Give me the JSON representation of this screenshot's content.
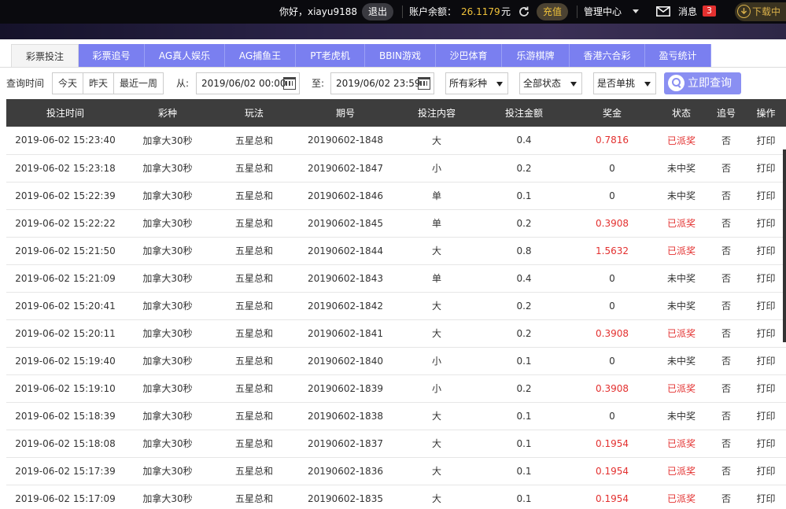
{
  "topbar": {
    "greeting": "你好，xiayu9188",
    "logout": "退出",
    "balance_label": "账户余额：",
    "balance_value": "26.1179",
    "balance_unit": "元",
    "recharge": "充值",
    "manage": "管理中心",
    "messages": "消息",
    "message_count": "3",
    "download": "下载中"
  },
  "tabs": [
    "彩票投注",
    "彩票追号",
    "AG真人娱乐",
    "AG捕鱼王",
    "PT老虎机",
    "BBIN游戏",
    "沙巴体育",
    "乐游棋牌",
    "香港六合彩",
    "盈亏统计"
  ],
  "filters": {
    "query_label": "查询时间",
    "quick": [
      "今天",
      "昨天",
      "最近一周"
    ],
    "from_label": "从:",
    "from_value": "2019/06/02 00:00",
    "to_label": "至:",
    "to_value": "2019/06/02 23:59",
    "lottery_select": "所有彩种",
    "status_select": "全部状态",
    "single_select": "是否单挑",
    "search_button": "立即查询"
  },
  "table": {
    "headers": [
      "投注时间",
      "彩种",
      "玩法",
      "期号",
      "投注内容",
      "投注金额",
      "奖金",
      "状态",
      "追号",
      "操作"
    ],
    "rows": [
      [
        "2019-06-02 15:23:40",
        "加拿大30秒",
        "五星总和",
        "20190602-1848",
        "大",
        "0.4",
        "0.7816",
        "已派奖",
        "否",
        "打印"
      ],
      [
        "2019-06-02 15:23:18",
        "加拿大30秒",
        "五星总和",
        "20190602-1847",
        "小",
        "0.2",
        "0",
        "未中奖",
        "否",
        "打印"
      ],
      [
        "2019-06-02 15:22:39",
        "加拿大30秒",
        "五星总和",
        "20190602-1846",
        "单",
        "0.1",
        "0",
        "未中奖",
        "否",
        "打印"
      ],
      [
        "2019-06-02 15:22:22",
        "加拿大30秒",
        "五星总和",
        "20190602-1845",
        "单",
        "0.2",
        "0.3908",
        "已派奖",
        "否",
        "打印"
      ],
      [
        "2019-06-02 15:21:50",
        "加拿大30秒",
        "五星总和",
        "20190602-1844",
        "大",
        "0.8",
        "1.5632",
        "已派奖",
        "否",
        "打印"
      ],
      [
        "2019-06-02 15:21:09",
        "加拿大30秒",
        "五星总和",
        "20190602-1843",
        "单",
        "0.4",
        "0",
        "未中奖",
        "否",
        "打印"
      ],
      [
        "2019-06-02 15:20:41",
        "加拿大30秒",
        "五星总和",
        "20190602-1842",
        "大",
        "0.2",
        "0",
        "未中奖",
        "否",
        "打印"
      ],
      [
        "2019-06-02 15:20:11",
        "加拿大30秒",
        "五星总和",
        "20190602-1841",
        "大",
        "0.2",
        "0.3908",
        "已派奖",
        "否",
        "打印"
      ],
      [
        "2019-06-02 15:19:40",
        "加拿大30秒",
        "五星总和",
        "20190602-1840",
        "小",
        "0.1",
        "0",
        "未中奖",
        "否",
        "打印"
      ],
      [
        "2019-06-02 15:19:10",
        "加拿大30秒",
        "五星总和",
        "20190602-1839",
        "小",
        "0.2",
        "0.3908",
        "已派奖",
        "否",
        "打印"
      ],
      [
        "2019-06-02 15:18:39",
        "加拿大30秒",
        "五星总和",
        "20190602-1838",
        "大",
        "0.1",
        "0",
        "未中奖",
        "否",
        "打印"
      ],
      [
        "2019-06-02 15:18:08",
        "加拿大30秒",
        "五星总和",
        "20190602-1837",
        "大",
        "0.1",
        "0.1954",
        "已派奖",
        "否",
        "打印"
      ],
      [
        "2019-06-02 15:17:39",
        "加拿大30秒",
        "五星总和",
        "20190602-1836",
        "大",
        "0.1",
        "0.1954",
        "已派奖",
        "否",
        "打印"
      ],
      [
        "2019-06-02 15:17:09",
        "加拿大30秒",
        "五星总和",
        "20190602-1835",
        "大",
        "0.1",
        "0.1954",
        "已派奖",
        "否",
        "打印"
      ]
    ]
  },
  "colors": {
    "accent": "#7a7ff0",
    "won_red": "#e3302f",
    "gold": "#f0c23a",
    "header_bg": "#3d3d3d"
  },
  "icons": [
    "refresh-icon",
    "chevron-down-icon",
    "mail-icon",
    "download-icon",
    "calendar-icon",
    "search-icon"
  ]
}
